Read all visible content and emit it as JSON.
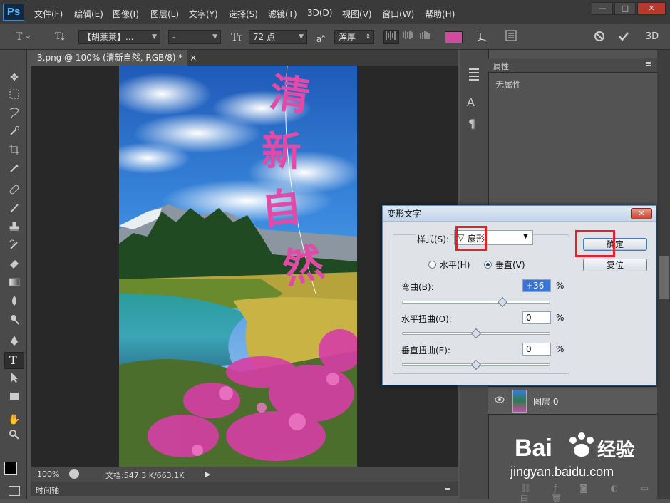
{
  "app": {
    "logo": "Ps"
  },
  "menu": [
    "文件(F)",
    "编辑(E)",
    "图像(I)",
    "图层(L)",
    "文字(Y)",
    "选择(S)",
    "滤镜(T)",
    "3D(D)",
    "视图(V)",
    "窗口(W)",
    "帮助(H)"
  ],
  "window_controls": {
    "minimize": "—",
    "maximize": "□",
    "close": "✕"
  },
  "options": {
    "font_family": "【胡莱莱】...",
    "font_style": "-",
    "font_size": "72 点",
    "aa_label": "a",
    "antialias": "浑厚",
    "color": "#d04a9e"
  },
  "document": {
    "tab_title": "3.png @ 100% (清新自然, RGB/8) *",
    "close": "×"
  },
  "canvas_text": [
    "清",
    "新",
    "自",
    "然"
  ],
  "status": {
    "zoom": "100%",
    "doc_size": "文档:547.3 K/663.1K"
  },
  "timeline_label": "时间轴",
  "properties": {
    "tab": "属性",
    "empty": "无属性"
  },
  "layers": {
    "layer_name": "图层 0"
  },
  "dialog": {
    "title": "变形文字",
    "style_label": "样式(S):",
    "style_value": "扇形",
    "horizontal": "水平(H)",
    "vertical": "垂直(V)",
    "orientation": "vertical",
    "bend_label": "弯曲(B):",
    "bend_value": "+36",
    "hdist_label": "水平扭曲(O):",
    "hdist_value": "0",
    "vdist_label": "垂直扭曲(E):",
    "vdist_value": "0",
    "percent": "%",
    "ok": "确定",
    "reset": "复位",
    "bend_level": 36,
    "hdist_level": 0,
    "vdist_level": 0
  },
  "watermark": {
    "brand": "Bai",
    "brand2": "经验",
    "url": "jingyan.baidu.com"
  }
}
